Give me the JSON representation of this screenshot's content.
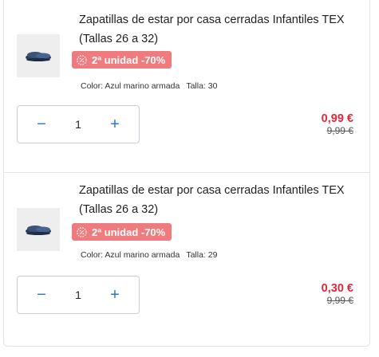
{
  "colors": {
    "accent": "#2f76c6",
    "promo_badge": "#f07b7e",
    "price_now": "#e0283b",
    "border": "#dfe3ea"
  },
  "cart": {
    "items": [
      {
        "title": "Zapatillas de estar por casa cerradas Infantiles TEX (Tallas 26 a 32)",
        "image_icon": "slipper-image",
        "promo": {
          "icon": "discount-icon",
          "label": "2ª unidad -70%"
        },
        "color_label": "Color: Azul marino armada",
        "size_label": "Talla: 30",
        "quantity": "1",
        "minus_label": "−",
        "plus_label": "+",
        "price_now": "0,99 €",
        "price_old": "9,99 €"
      },
      {
        "title": "Zapatillas de estar por casa cerradas Infantiles TEX (Tallas 26 a 32)",
        "image_icon": "slipper-image",
        "promo": {
          "icon": "discount-icon",
          "label": "2ª unidad -70%"
        },
        "color_label": "Color: Azul marino armada",
        "size_label": "Talla: 29",
        "quantity": "1",
        "minus_label": "−",
        "plus_label": "+",
        "price_now": "0,30 €",
        "price_old": "9,99 €"
      }
    ]
  }
}
